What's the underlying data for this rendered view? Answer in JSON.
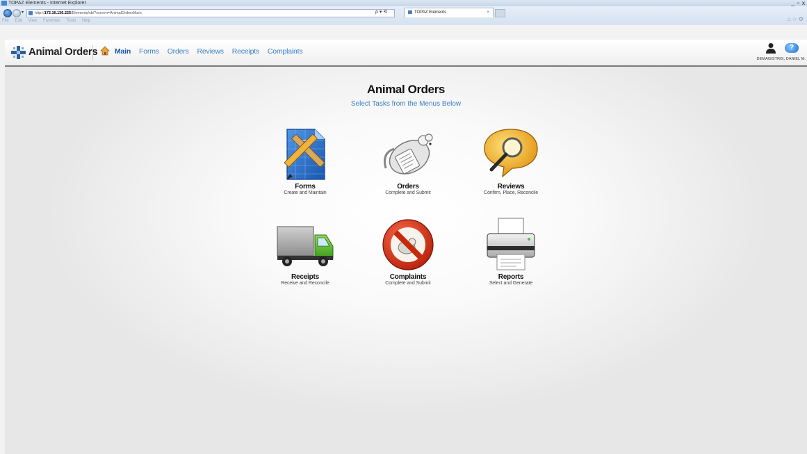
{
  "browser": {
    "window_title": "TOPAZ Elements - Internet Explorer",
    "window_controls": "_ ▫ x",
    "url_prefix": "http://",
    "url_host": "172.16.136.225",
    "url_path": "/Elements/sb/?screen=AnimalOrdersMain",
    "url_tools": "ρ ▾ ⟲",
    "tab_title": "TOPAZ Elements",
    "tab_close": "×",
    "menu": [
      "File",
      "Edit",
      "View",
      "Favorites",
      "Tools",
      "Help"
    ]
  },
  "header": {
    "brand": "Animal Orders",
    "nav": [
      "Main",
      "Forms",
      "Orders",
      "Reviews",
      "Receipts",
      "Complaints"
    ],
    "active_nav": "Main",
    "help_label": "?",
    "user_name": "DEMAGISTRIS, DANIEL M."
  },
  "main": {
    "title": "Animal Orders",
    "subtitle": "Select Tasks from the Menus Below",
    "tiles": [
      {
        "label": "Forms",
        "desc": "Create and Maintain",
        "icon": "forms-icon"
      },
      {
        "label": "Orders",
        "desc": "Complete and Submit",
        "icon": "orders-mouse-icon"
      },
      {
        "label": "Reviews",
        "desc": "Confirm, Place, Reconcile",
        "icon": "reviews-magnifier-icon"
      },
      {
        "label": "Receipts",
        "desc": "Receive and Reconcile",
        "icon": "receipts-truck-icon"
      },
      {
        "label": "Complaints",
        "desc": "Complete and Submit",
        "icon": "complaints-no-mouse-icon"
      },
      {
        "label": "Reports",
        "desc": "Select and Generate",
        "icon": "reports-printer-icon"
      }
    ]
  },
  "colors": {
    "link_blue": "#3d80c6",
    "active_blue": "#1d56a3",
    "header_border": "#7a7a7a"
  }
}
